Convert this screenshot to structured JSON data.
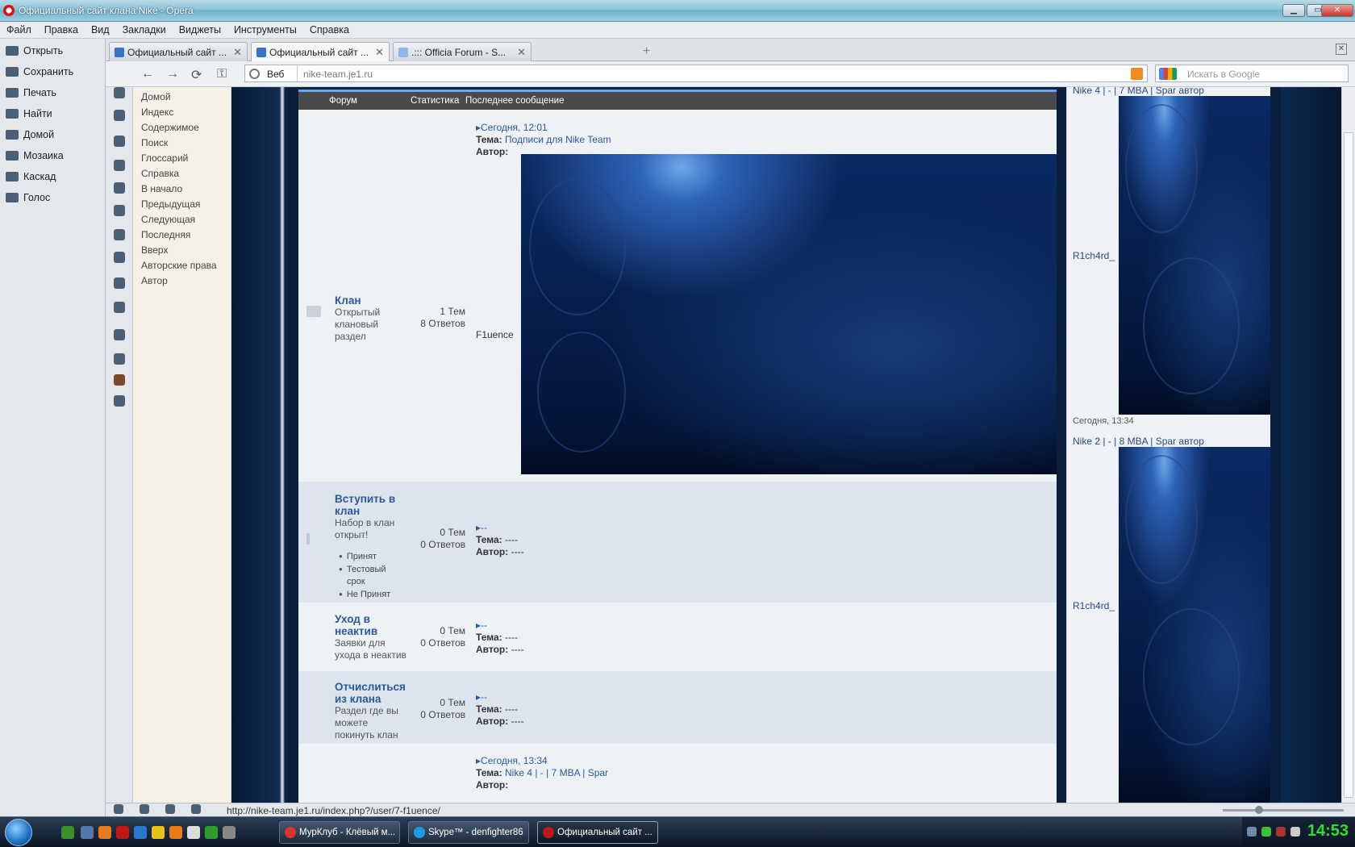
{
  "window": {
    "title": "Официальный сайт клана Nike - Opera",
    "min": "▁",
    "max": "▭",
    "close": "✕"
  },
  "menu": [
    "Файл",
    "Правка",
    "Вид",
    "Закладки",
    "Виджеты",
    "Инструменты",
    "Справка"
  ],
  "panel": [
    "Открыть",
    "Сохранить",
    "Печать",
    "Найти",
    "Домой",
    "Мозаика",
    "Каскад",
    "Голос"
  ],
  "tabs": [
    {
      "label": "Официальный сайт ...",
      "close": "✕"
    },
    {
      "label": "Официальный сайт ...",
      "close": "✕"
    },
    {
      "label": ".::: Officia Forum - S...",
      "close": "✕"
    }
  ],
  "newtab": "+",
  "tabclose": "✕",
  "nav": {
    "back": "←",
    "forward": "→",
    "reload": "⟳",
    "key": "⚿",
    "web_label": "Веб",
    "url": "nike-team.je1.ru",
    "search_placeholder": "Искать в Google",
    "search_icon": "⌕"
  },
  "bookmarks": [
    "Домой",
    "Индекс",
    "Содержимое",
    "Поиск",
    "Глоссарий",
    "Справка",
    "В начало",
    "Предыдущая",
    "Следующая",
    "Последняя",
    "Вверх",
    "Авторские права",
    "Автор"
  ],
  "forum": {
    "headers": {
      "forum": "Форум",
      "stats": "Статистика",
      "last": "Последнее сообщение"
    },
    "rows": [
      {
        "name": "Клан",
        "desc_lines": [
          "Открытый",
          "клановый",
          "раздел"
        ],
        "topics": "1 Тем",
        "replies": "8 Ответов",
        "last_date": "Сегодня, 12:01",
        "topic_label": "Тема:",
        "topic": "Подписи для Nike Team",
        "author_label": "Автор:",
        "author": "F1uence"
      },
      {
        "name_lines": [
          "Вступить в",
          "клан"
        ],
        "desc_lines": [
          "Набор в клан",
          "открыт!"
        ],
        "sub": [
          "Принят",
          "Тестовый",
          "срок",
          "Не Принят"
        ],
        "topics": "0 Тем",
        "replies": "0 Ответов",
        "last_date": "--",
        "topic_label": "Тема:",
        "topic": "----",
        "author_label": "Автор:",
        "author": "----"
      },
      {
        "name_lines": [
          "Уход в",
          "неактив"
        ],
        "desc_lines": [
          "Заявки для",
          "ухода в неактив"
        ],
        "topics": "0 Тем",
        "replies": "0 Ответов",
        "last_date": "--",
        "topic_label": "Тема:",
        "topic": "----",
        "author_label": "Автор:",
        "author": "----"
      },
      {
        "name_lines": [
          "Отчислиться",
          "из клана"
        ],
        "desc_lines": [
          "Раздел где вы",
          "можете",
          "покинуть клан"
        ],
        "topics": "0 Тем",
        "replies": "0 Ответов",
        "last_date": "--",
        "topic_label": "Тема:",
        "topic": "----",
        "author_label": "Автор:",
        "author": "----"
      },
      {
        "last_date": "Сегодня, 13:34",
        "topic_label": "Тема:",
        "topic": "Nike 4 | - | 7 MBA | Spar",
        "author_label": "Автор:"
      }
    ]
  },
  "right": {
    "posts": [
      {
        "title": "Nike 4 | - | 7 MBA | Spar автор",
        "user": "R1ch4rd_",
        "date": "Сегодня, 13:34"
      },
      {
        "title": "Nike 2 | - | 8 MBA | Spar автор",
        "user": "R1ch4rd_"
      }
    ]
  },
  "status": {
    "url": "http://nike-team.je1.ru/index.php?/user/7-f1uence/"
  },
  "taskbar": {
    "tasks": [
      "МурКлуб - Клёвый м...",
      "Skype™ - denfighter86",
      "Официальный сайт ..."
    ],
    "clock": "14:53",
    "colors": {
      "clock": "#2ee02e"
    }
  }
}
